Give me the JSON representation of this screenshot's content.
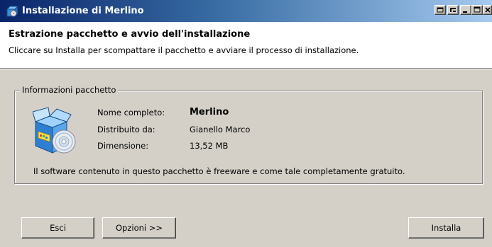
{
  "window": {
    "title": "Installazione di Merlino",
    "icon": "installer-box-icon",
    "controls": [
      "restore-icon",
      "pin-icon",
      "minimize-icon",
      "maximize-icon",
      "close-icon"
    ]
  },
  "header": {
    "title": "Estrazione pacchetto e avvio dell'installazione",
    "subtitle": "Cliccare su Installa per scompattare il pacchetto e avviare il processo di installazione."
  },
  "package_info": {
    "group_title": "Informazioni pacchetto",
    "icon": "software-package-cd-icon",
    "rows": [
      {
        "label": "Nome completo:",
        "value": "Merlino"
      },
      {
        "label": "Distribuito da:",
        "value": "Gianello Marco"
      },
      {
        "label": "Dimensione:",
        "value": "13,52 MB"
      }
    ],
    "description": "Il software contenuto in questo pacchetto è freeware e come tale completamente gratuito."
  },
  "buttons": {
    "exit": "Esci",
    "options": "Opzioni >>",
    "install": "Installa"
  },
  "colors": {
    "titlebar_start": "#0a246a",
    "titlebar_end": "#a6caf0",
    "face": "#d4d0c8",
    "header_bg": "#ffffff"
  }
}
